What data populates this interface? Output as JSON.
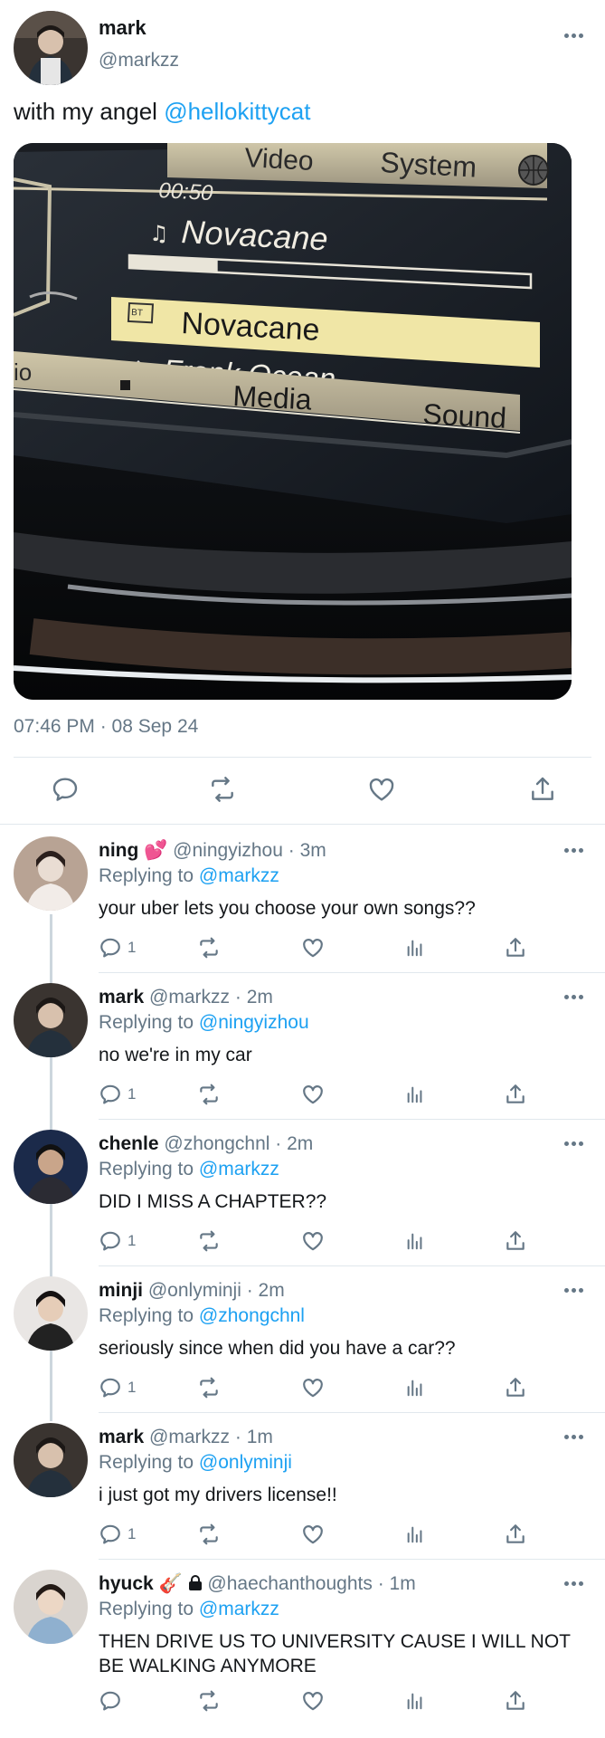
{
  "main": {
    "name": "mark",
    "handle": "@markzz",
    "text_prefix": "with my angel ",
    "text_mention": "@hellokittycat",
    "timestamp": "07:46 PM · 08 Sep 24",
    "media": {
      "top_tabs": [
        "Video",
        "System"
      ],
      "time": "00:50",
      "now_playing": "Novacane",
      "list": [
        "Novacane",
        "Frank Ocean"
      ],
      "bt_label": "BT",
      "left_edge": "io",
      "bottom_tabs": [
        "Media",
        "Sound"
      ],
      "progress": 0.22
    }
  },
  "replies": [
    {
      "name": "ning",
      "emoji": "💕",
      "handle": "@ningyizhou",
      "time": "3m",
      "replying_prefix": "Replying to ",
      "replying_to": "@markzz",
      "text": "your uber lets you choose your own songs??",
      "reply_count": "1"
    },
    {
      "name": "mark",
      "handle": "@markzz",
      "time": "2m",
      "replying_prefix": "Replying to ",
      "replying_to": "@ningyizhou",
      "text": "no we're in my car",
      "reply_count": "1"
    },
    {
      "name": "chenle",
      "handle": "@zhongchnl",
      "time": "2m",
      "replying_prefix": "Replying to ",
      "replying_to": "@markzz",
      "text": "DID I MISS A CHAPTER??",
      "reply_count": "1"
    },
    {
      "name": "minji",
      "handle": "@onlyminji",
      "time": "2m",
      "replying_prefix": "Replying to ",
      "replying_to": "@zhongchnl",
      "text": "seriously since when did you have a car??",
      "reply_count": "1"
    },
    {
      "name": "mark",
      "handle": "@markzz",
      "time": "1m",
      "replying_prefix": "Replying to ",
      "replying_to": "@onlyminji",
      "text": "i just got my drivers license!!",
      "reply_count": "1"
    },
    {
      "name": "hyuck",
      "emoji": "🎸",
      "handle": "@haechanthoughts",
      "time": "1m",
      "replying_prefix": "Replying to ",
      "replying_to": "@markzz",
      "text": "THEN DRIVE US TO UNIVERSITY CAUSE I WILL NOT BE WALKING ANYMORE",
      "reply_count": ""
    }
  ],
  "separator": " · ",
  "colors": {
    "accent": "#1da1f2",
    "secondary_text": "#657786",
    "divider": "#e1e8ed",
    "thread_line": "#ccd6dd"
  },
  "icons": [
    "reply-icon",
    "retweet-icon",
    "like-icon",
    "views-icon",
    "share-icon",
    "more-icon",
    "lock-icon"
  ]
}
